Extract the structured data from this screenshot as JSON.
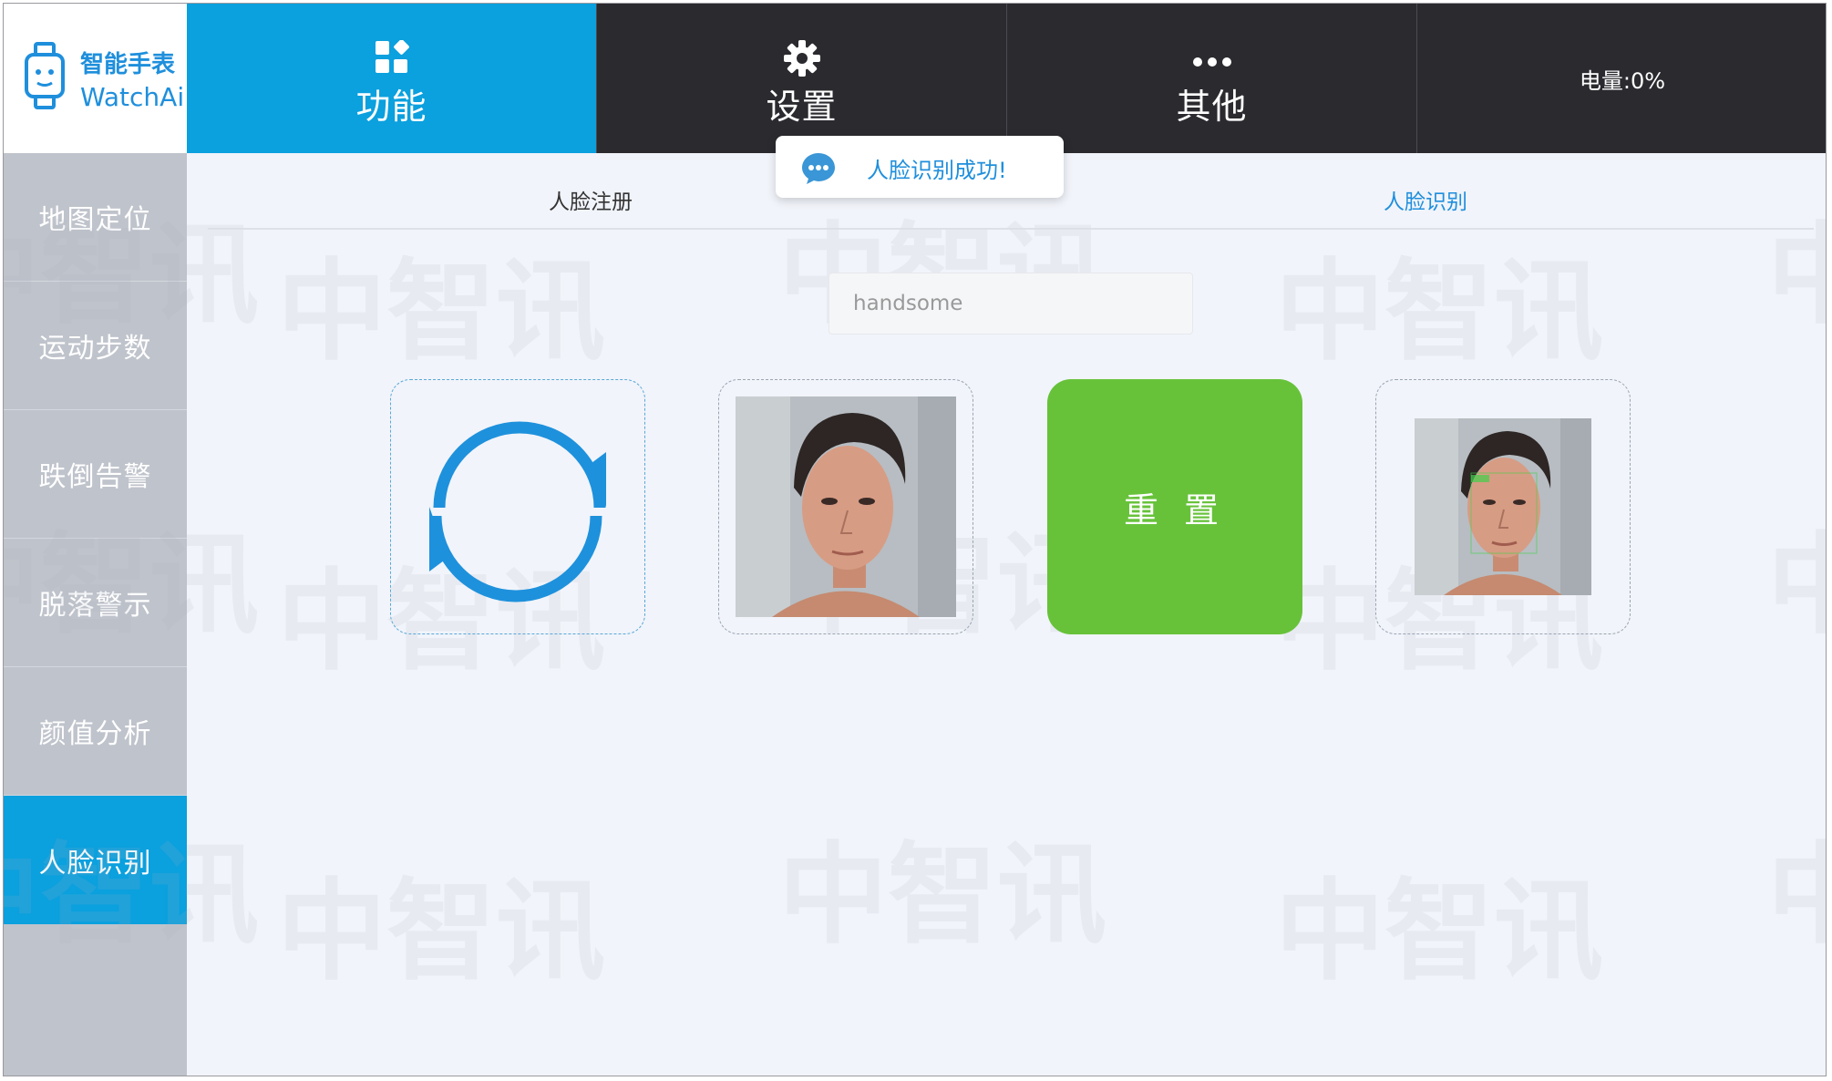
{
  "logo": {
    "line1": "智能手表",
    "line2": "WatchAi",
    "icon": "smartwatch-icon"
  },
  "topnav": {
    "tabs": [
      {
        "label": "功能",
        "icon": "grid-icon",
        "active": true
      },
      {
        "label": "设置",
        "icon": "gear-icon",
        "active": false
      },
      {
        "label": "其他",
        "icon": "more-dots-icon",
        "active": false
      }
    ],
    "battery": "电量:0%"
  },
  "sidebar": {
    "items": [
      {
        "label": "地图定位"
      },
      {
        "label": "运动步数"
      },
      {
        "label": "跌倒告警"
      },
      {
        "label": "脱落警示"
      },
      {
        "label": "颜值分析"
      },
      {
        "label": "人脸识别",
        "active": true
      }
    ]
  },
  "subtabs": {
    "register": "人脸注册",
    "recognize": "人脸识别"
  },
  "form": {
    "name_value": "handsome"
  },
  "cards": {
    "reset_label": "重 置",
    "refresh_icon": "refresh-icon"
  },
  "toast": {
    "text": "人脸识别成功!",
    "icon": "chat-bubble-icon"
  },
  "watermark": "中智讯",
  "colors": {
    "accent": "#0ba0de",
    "nav_dark": "#2b2a2f",
    "sidebar": "#bfc3cb",
    "reset_green": "#67c23a"
  }
}
